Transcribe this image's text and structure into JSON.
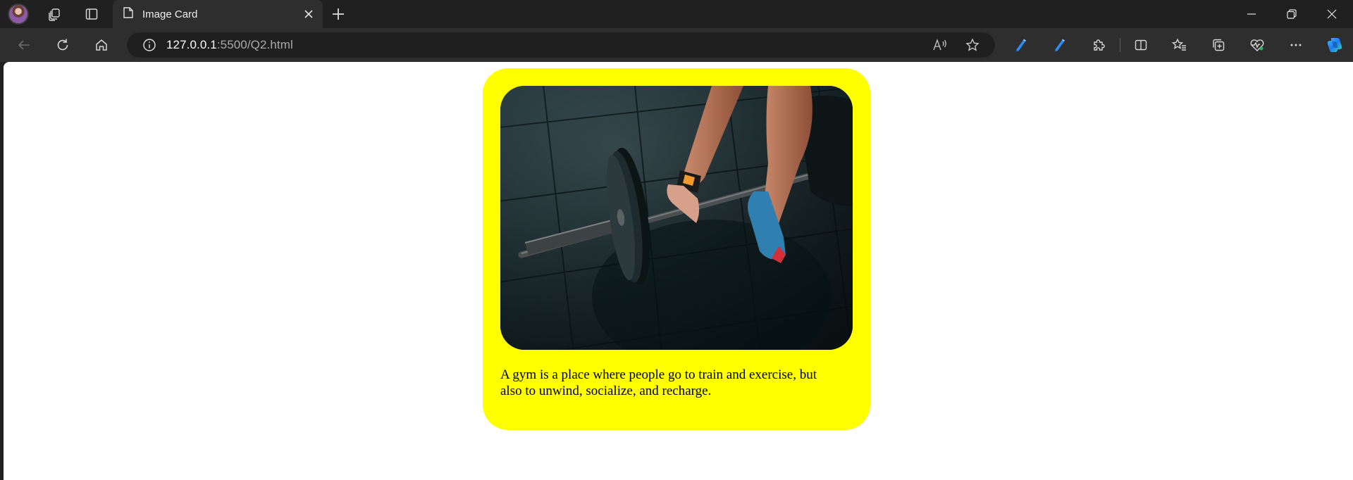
{
  "browser": {
    "tab": {
      "title": "Image Card"
    },
    "address": {
      "host": "127.0.0.1",
      "rest": ":5500/Q2.html"
    },
    "icons": {
      "tabbar": [
        "profile-avatar",
        "workspaces-icon",
        "tab-actions-icon",
        "page-icon",
        "close-icon",
        "plus-icon"
      ],
      "window": [
        "minimize-icon",
        "restore-icon",
        "close-window-icon"
      ],
      "toolbar": [
        "back-icon",
        "refresh-icon",
        "home-icon",
        "info-icon",
        "read-aloud-icon",
        "favorite-star-icon",
        "pen-icon",
        "pen-icon",
        "extensions-icon",
        "split-screen-icon",
        "favorites-icon",
        "collections-icon",
        "browser-essentials-icon",
        "more-icon",
        "copilot-icon"
      ]
    }
  },
  "page": {
    "card": {
      "background": "#ffff00",
      "image_subject": "barbell-deadlift-photo",
      "text": "A gym is a place where people go to train and exercise, but also to unwind, socialize, and recharge."
    }
  }
}
